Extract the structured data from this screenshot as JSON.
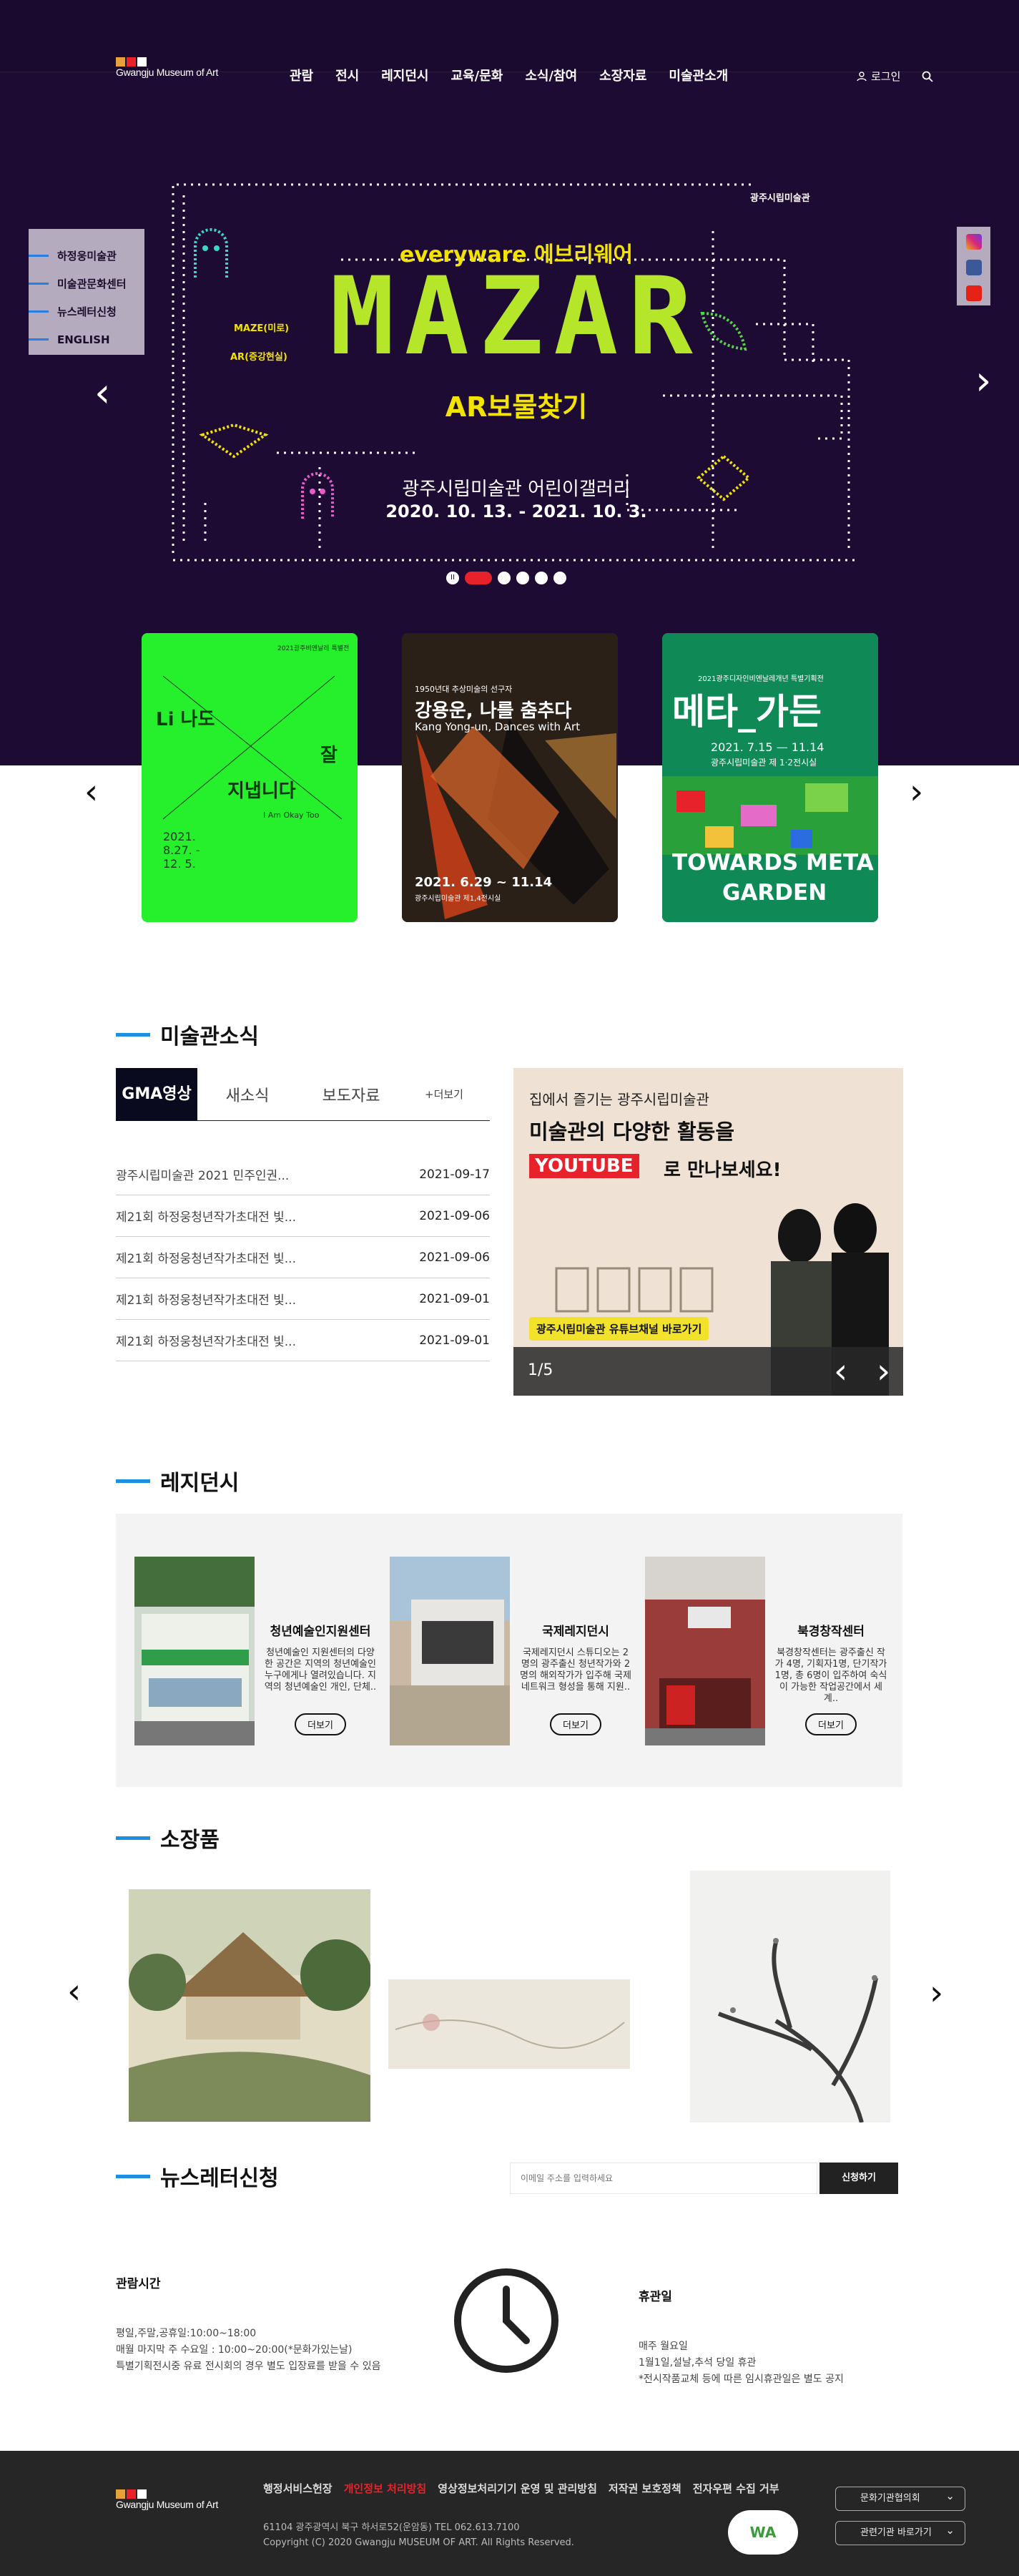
{
  "header": {
    "logo_text": "Gwangju Museum of Art",
    "nav": [
      "관람",
      "전시",
      "레지던시",
      "교육/문화",
      "소식/참여",
      "소장자료",
      "미술관소개"
    ],
    "login": "로그인"
  },
  "quick_menu": [
    "하정웅미술관",
    "미술관문화센터",
    "뉴스레터신청",
    "ENGLISH"
  ],
  "banner": {
    "top_title": "everyware 에브리웨어",
    "big_title": "MAZAR",
    "maze": "MAZE(미로)",
    "ar": "AR(증강현실)",
    "subtitle": "AR보물찾기",
    "gallery": "광주시립미술관 어린이갤러리",
    "dates": "2020. 10. 13. - 2021. 10. 3.",
    "corner": "광주시립미술관"
  },
  "posters": [
    {
      "lines": [
        "2021광주비엔날레 특별전",
        "Li 나도",
        "잘",
        "지냅니다",
        "I Am Okay Too",
        "2021. 8.27. - 12. 5."
      ]
    },
    {
      "lines": [
        "1950년대 추상미술의 선구자",
        "강용운, 나를 춤추다",
        "Kang Yong-un, Dances with Art",
        "2021. 6.29 ~ 11.14",
        "광주시립미술관 제1,4전시실"
      ]
    },
    {
      "lines": [
        "2021광주디자인비엔날레개년 특별기획전",
        "메타_가든",
        "2021. 7.15 — 11.14",
        "광주시립미술관 제 1·2전시실",
        "TOWARDS META",
        "GARDEN"
      ]
    }
  ],
  "news": {
    "title": "미술관소식",
    "tabs": [
      "GMA영상",
      "새소식",
      "보도자료"
    ],
    "more": "+더보기",
    "items": [
      {
        "t": "광주시립미술관 2021 민주인권...",
        "d": "2021-09-17"
      },
      {
        "t": "제21회 하정웅청년작가초대전 빛...",
        "d": "2021-09-06"
      },
      {
        "t": "제21회 하정웅청년작가초대전 빛...",
        "d": "2021-09-06"
      },
      {
        "t": "제21회 하정웅청년작가초대전 빛...",
        "d": "2021-09-01"
      },
      {
        "t": "제21회 하정웅청년작가초대전 빛...",
        "d": "2021-09-01"
      }
    ],
    "promo": {
      "l1": "집에서 즐기는 광주시립미술관",
      "l2": "미술관의 다양한 활동을",
      "yt": "YOUTUBE",
      "l3": "로 만나보세요!",
      "tag": "광주시립미술관 유튜브채널 바로가기",
      "counter": "1/5"
    }
  },
  "residency": {
    "title": "레지던시",
    "items": [
      {
        "name": "청년예술인지원센터",
        "desc": "청년예술인 지원센터의 다양한 공간은 지역의 청년예술인 누구에게나 열려있습니다. 지역의 청년예술인 개인, 단체..",
        "more": "더보기"
      },
      {
        "name": "국제레지던시",
        "desc": "국제레지던시 스튜디오는 2명의 광주출신 청년작가와 2명의 해외작가가 입주해 국제 네트워크 형성을 통해 지원..",
        "more": "더보기"
      },
      {
        "name": "북경창작센터",
        "desc": "북경창작센터는 광주출신 작가 4명, 기획자1명, 단기작가 1명, 총 6명이 입주하여 숙식이 가능한 작업공간에서 세계..",
        "more": "더보기"
      }
    ]
  },
  "collection": {
    "title": "소장품"
  },
  "newsletter": {
    "title": "뉴스레터신청",
    "placeholder": "이메일 주소를 입력하세요",
    "button": "신청하기"
  },
  "hours": {
    "title": "관람시간",
    "lines": [
      "평일,주말,공휴일:10:00~18:00",
      "매월 마지막 주 수요일 : 10:00~20:00(*문화가있는날)",
      "특별기획전시중 유료 전시회의 경우 별도 입장료를 받을 수 있음"
    ]
  },
  "closed": {
    "title": "휴관일",
    "lines": [
      "매주 월요일",
      "1월1일,설날,추석 당일 휴관",
      "*전시작품교체 등에 따른 임시휴관일은 별도 공지"
    ]
  },
  "footer": {
    "links": [
      "행정서비스헌장",
      "개인정보 처리방침",
      "영상정보처리기기 운영 및 관리방침",
      "저작권 보호정책",
      "전자우편 수집 거부"
    ],
    "address": "61104 광주광역시 북구 하서로52(운암동) TEL 062.613.7100",
    "copyright": "Copyright (C) 2020 Gwangju MUSEUM OF ART. All Rights Reserved.",
    "select1": "문화기관협의회",
    "select2": "관련기관 바로가기",
    "badge": "WA"
  },
  "colors": {
    "hero": "#1e0b33",
    "accent": "#1a8fe3",
    "red": "#e8222b"
  }
}
